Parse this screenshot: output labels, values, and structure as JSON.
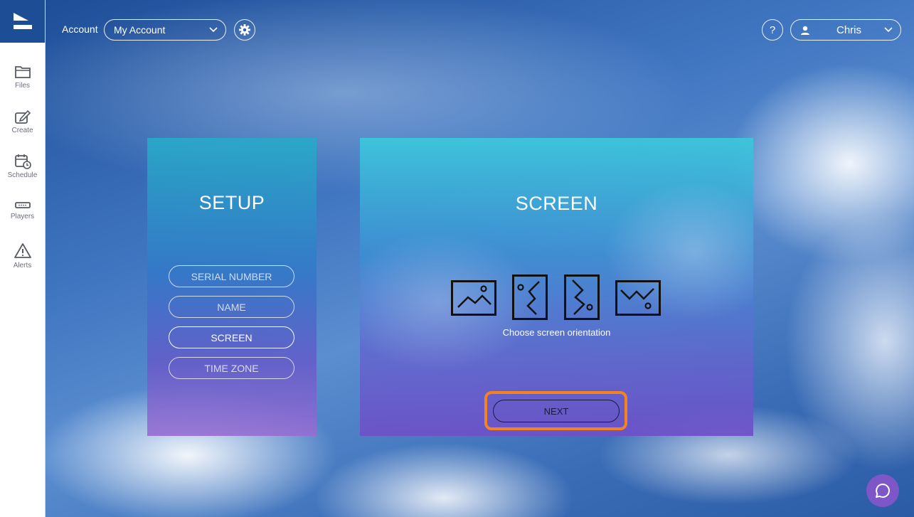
{
  "topbar": {
    "account_label": "Account",
    "account_select_value": "My Account",
    "help_label": "?",
    "user_name": "Chris"
  },
  "sidebar": {
    "items": [
      {
        "label": "Files",
        "icon": "folder-icon"
      },
      {
        "label": "Create",
        "icon": "edit-icon"
      },
      {
        "label": "Schedule",
        "icon": "calendar-clock-icon"
      },
      {
        "label": "Players",
        "icon": "player-device-icon"
      },
      {
        "label": "Alerts",
        "icon": "warning-icon"
      }
    ]
  },
  "setup": {
    "title": "SETUP",
    "steps": [
      "SERIAL NUMBER",
      "NAME",
      "SCREEN",
      "TIME ZONE"
    ],
    "active_step": "SCREEN"
  },
  "screen": {
    "title": "SCREEN",
    "orientations": [
      "landscape",
      "portrait-rotated-left",
      "portrait-rotated-right",
      "landscape-flipped"
    ],
    "caption": "Choose screen orientation",
    "next_label": "NEXT"
  },
  "colors": {
    "highlight": "#f5821f",
    "logo_bg": "#1d4e95",
    "chat_bg": "#7d56c8"
  }
}
